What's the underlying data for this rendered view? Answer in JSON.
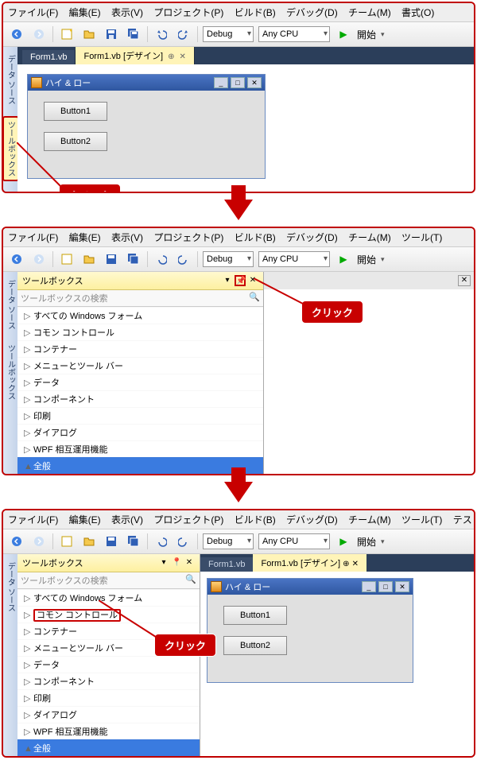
{
  "menu": {
    "file": "ファイル(F)",
    "edit": "編集(E)",
    "view": "表示(V)",
    "project": "プロジェクト(P)",
    "build": "ビルド(B)",
    "debug": "デバッグ(D)",
    "team": "チーム(M)",
    "format": "書式(O)",
    "tools": "ツール(T)",
    "test": "テスト(S)"
  },
  "toolbar": {
    "config": "Debug",
    "platform": "Any CPU",
    "start": "開始"
  },
  "sidetabs": {
    "datasource": "データ ソース",
    "toolbox": "ツールボックス"
  },
  "tabs": {
    "form_vb": "Form1.vb",
    "form_design": "Form1.vb [デザイン]"
  },
  "form": {
    "title": "ハイ & ロー",
    "button1": "Button1",
    "button2": "Button2"
  },
  "callout": {
    "click": "クリック"
  },
  "toolbox": {
    "title": "ツールボックス",
    "search": "ツールボックスの検索",
    "items": [
      "すべての Windows フォーム",
      "コモン コントロール",
      "コンテナー",
      "メニューとツール バー",
      "データ",
      "コンポーネント",
      "印刷",
      "ダイアログ",
      "WPF 相互運用機能"
    ],
    "general": "全般"
  }
}
